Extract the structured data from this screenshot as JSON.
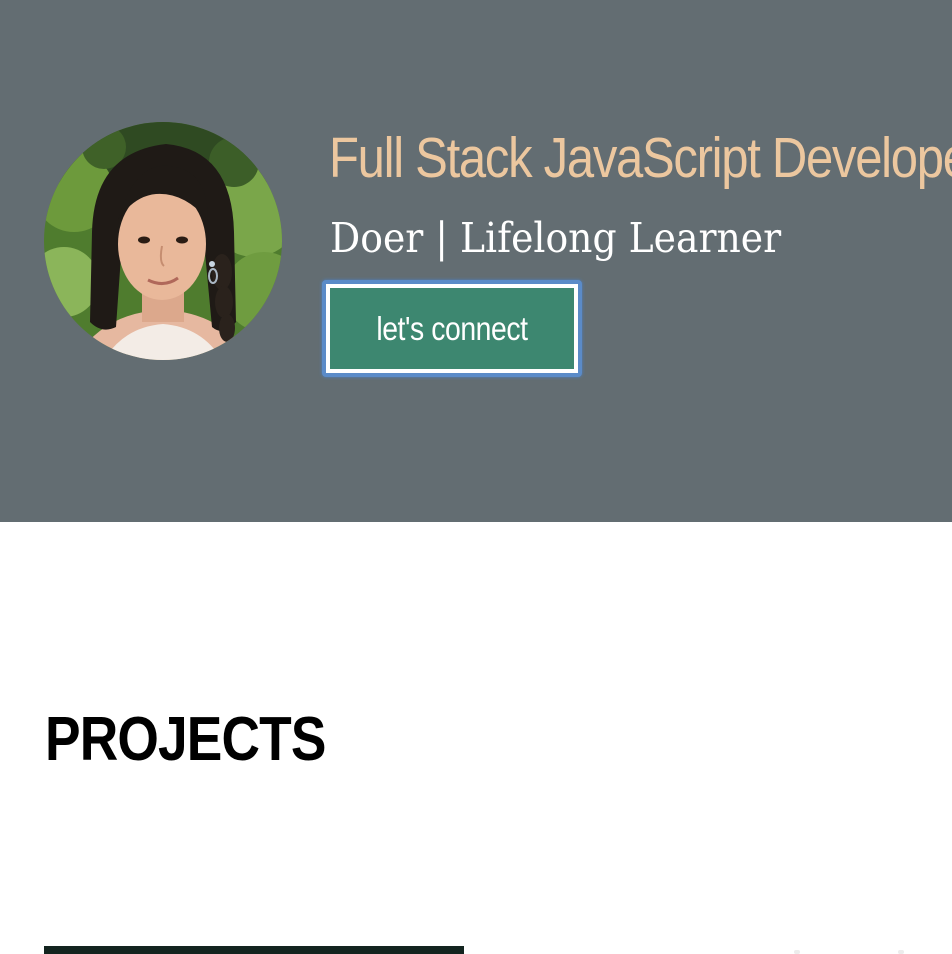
{
  "theme": {
    "hero_bg": "#636d72",
    "headline_color": "#ecc79f",
    "subhead_color": "#ffffff",
    "button_bg": "#3d8770",
    "button_text": "#ffffff",
    "focus_ring": "#5b8bc8"
  },
  "hero": {
    "avatar_icon": "profile-photo",
    "headline": "Full Stack JavaScript Developer",
    "subhead": "Doer | Lifelong Learner",
    "cta_label": "let's connect"
  },
  "projects": {
    "section_title": "PROJECTS"
  }
}
